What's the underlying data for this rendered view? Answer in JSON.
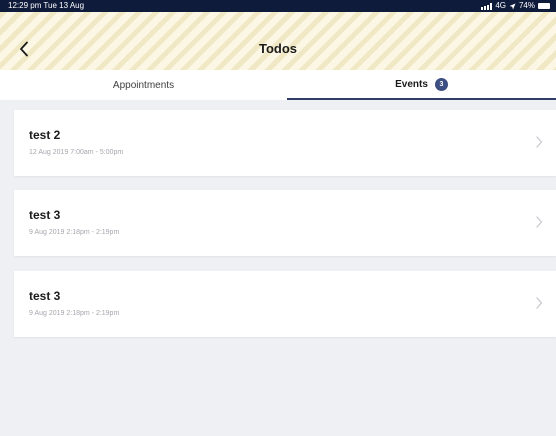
{
  "status_bar": {
    "time": "12:29 pm  Tue 13 Aug",
    "network": "4G",
    "battery": "74%"
  },
  "header": {
    "title": "Todos"
  },
  "tabs": [
    {
      "label": "Appointments",
      "active": false
    },
    {
      "label": "Events",
      "active": true,
      "badge": "3"
    }
  ],
  "events": [
    {
      "title": "test 2",
      "meta": "12 Aug 2019 7:00am - 5:00pm"
    },
    {
      "title": "test 3",
      "meta": "9 Aug 2019 2:18pm - 2:19pm"
    },
    {
      "title": "test 3",
      "meta": "9 Aug 2019 2:18pm - 2:19pm"
    }
  ],
  "colors": {
    "status_bar": "#0e1b3a",
    "header_bg": "#fbf7e4",
    "tab_indicator": "#2f3f68",
    "badge": "#3d4f82",
    "page_bg": "#eef0f4"
  },
  "icons": [
    "back-arrow-icon",
    "chevron-right-icon",
    "signal-icon",
    "location-icon",
    "battery-icon"
  ]
}
